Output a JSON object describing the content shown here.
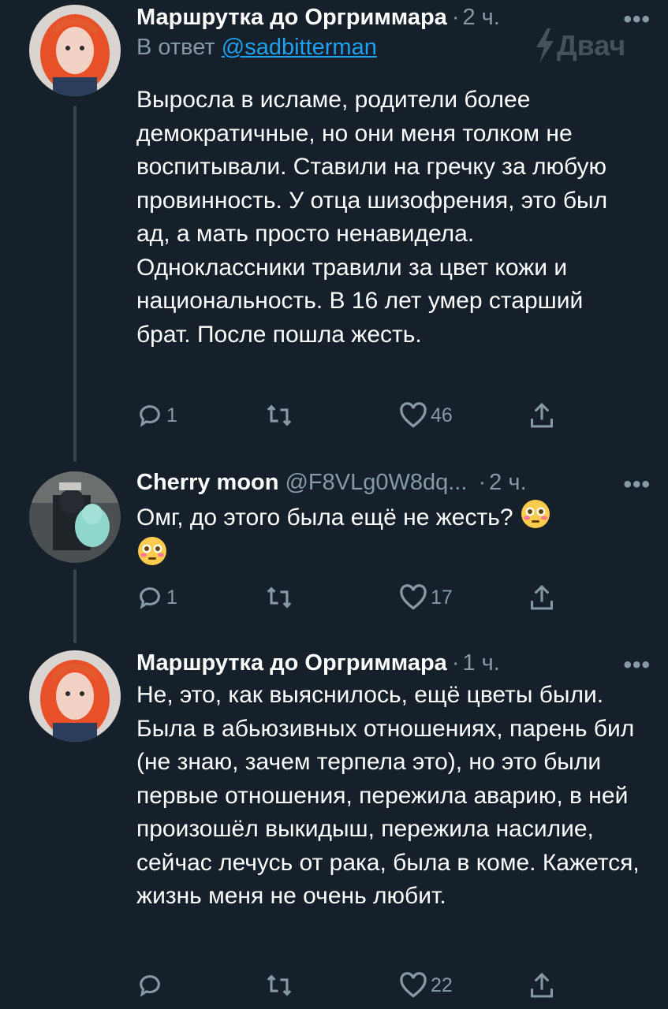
{
  "watermark": {
    "text": "Двач"
  },
  "tweets": [
    {
      "name": "Маршрутка до Оргриммара",
      "handle": "",
      "time": "2 ч.",
      "reply_label": "В ответ",
      "reply_to": "@sadbitterman",
      "text": "Выросла в исламе, родители более демократичные, но они меня толком не воспитывали. Ставили на гречку за любую провинность. У отца шизофрения, это был ад, а мать просто ненавидела. Одноклассники травили за цвет кожи и национальность. В 16 лет умер старший брат. После пошла жесть.",
      "replies": "1",
      "retweets": "",
      "likes": "46"
    },
    {
      "name": "Cherry moon",
      "handle": "@F8VLg0W8dq...",
      "time": "2 ч.",
      "text": "Омг, до этого была ещё не жесть?",
      "emoji_icon": "flushed-face",
      "replies": "1",
      "retweets": "",
      "likes": "17"
    },
    {
      "name": "Маршрутка до Оргриммара",
      "handle": "",
      "time": "1 ч.",
      "text": "Не, это, как выяснилось, ещё цветы были. Была в абьюзивных отношениях, парень бил (не знаю, зачем терпела это), но это были первые отношения, пережила аварию, в ней произошёл выкидыш, пережила насилие, сейчас лечусь от рака, была в коме. Кажется, жизнь меня не очень любит.",
      "replies": "",
      "retweets": "",
      "likes": "22"
    }
  ],
  "more_label": "•••",
  "colors": {
    "background": "#15202b",
    "muted": "#8899a6",
    "link": "#1da1f2",
    "thread_line": "#38444d"
  }
}
